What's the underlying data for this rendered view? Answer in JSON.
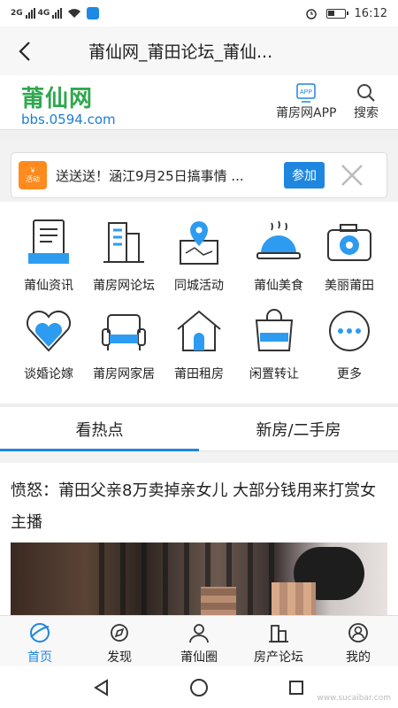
{
  "status": {
    "signal1": "2G",
    "signal2": "4G",
    "time": "16:12"
  },
  "titlebar": {
    "title": "莆仙网_莆田论坛_莆仙..."
  },
  "header": {
    "logo_text": "莆仙网",
    "logo_url": "bbs.0594.com",
    "app_label": "莆房网APP",
    "app_badge": "APP",
    "search_label": "搜索"
  },
  "activity": {
    "tag_top": "￥",
    "tag_label": "活动",
    "text": "送送送！涵江9月25日搞事情 ...",
    "join_label": "参加"
  },
  "grid": {
    "items": [
      {
        "label": "莆仙资讯",
        "icon": "news-icon"
      },
      {
        "label": "莆房网论坛",
        "icon": "building-icon"
      },
      {
        "label": "同城活动",
        "icon": "map-pin-icon"
      },
      {
        "label": "莆仙美食",
        "icon": "food-cloche-icon"
      },
      {
        "label": "美丽莆田",
        "icon": "camera-icon"
      },
      {
        "label": "谈婚论嫁",
        "icon": "heart-icon"
      },
      {
        "label": "莆房网家居",
        "icon": "sofa-icon"
      },
      {
        "label": "莆田租房",
        "icon": "house-icon"
      },
      {
        "label": "闲置转让",
        "icon": "bag-icon"
      },
      {
        "label": "更多",
        "icon": "more-icon"
      }
    ]
  },
  "tabs": [
    {
      "label": "看热点"
    },
    {
      "label": "新房/二手房"
    }
  ],
  "article": {
    "headline": "愤怒：莆田父亲8万卖掉亲女儿 大部分钱用来打赏女主播"
  },
  "bottomnav": [
    {
      "label": "首页",
      "icon": "home-planet-icon"
    },
    {
      "label": "发现",
      "icon": "discover-icon"
    },
    {
      "label": "莆仙圈",
      "icon": "circle-community-icon"
    },
    {
      "label": "房产论坛",
      "icon": "buildings-icon"
    },
    {
      "label": "我的",
      "icon": "profile-icon"
    }
  ],
  "watermark": "www.sucaibar.com",
  "colors": {
    "accent": "#1f86e0",
    "logo_green": "#2fa84f",
    "activity_orange": "#ff8a1e"
  }
}
